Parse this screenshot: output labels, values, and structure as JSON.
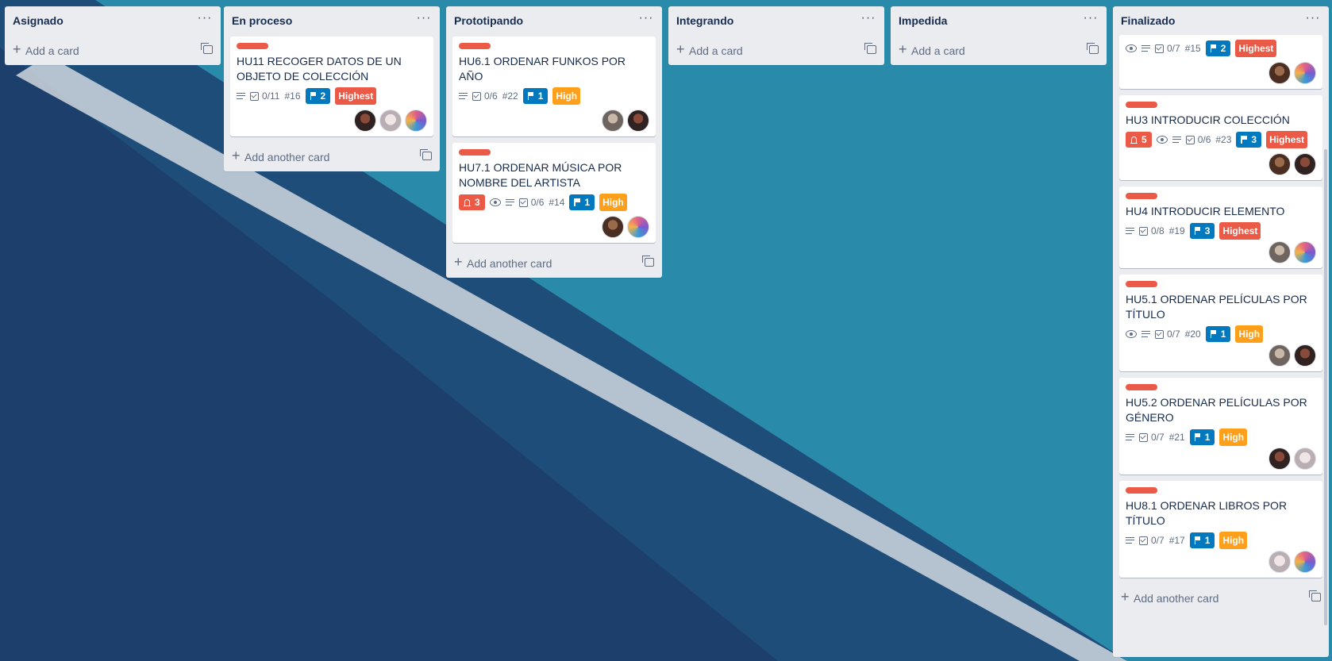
{
  "colors": {
    "board_bg": "#1d5a86",
    "list_bg": "#ebecf0",
    "red": "#eb5a46",
    "blue": "#0079bf",
    "orange": "#ff9f1a"
  },
  "icons": [
    "more-icon",
    "plus-icon",
    "template-icon",
    "description-icon",
    "checklist-icon",
    "flag-icon",
    "bell-icon",
    "eye-icon"
  ],
  "lists": [
    {
      "title": "Asignado",
      "add_label": "Add a card"
    },
    {
      "title": "En proceso",
      "add_label": "Add another card",
      "cards": [
        {
          "title": "HU11 RECOGER DATOS DE UN OBJETO DE COLECCIÓN",
          "checklist": "0/11",
          "number": "#16",
          "flag": "2",
          "priority": "Highest"
        }
      ]
    },
    {
      "title": "Prototipando",
      "add_label": "Add another card",
      "cards": [
        {
          "title": "HU6.1 ORDENAR FUNKOS POR AÑO",
          "checklist": "0/6",
          "number": "#22",
          "flag": "1",
          "priority": "High"
        },
        {
          "title": "HU7.1 ORDENAR MÚSICA POR NOMBRE DEL ARTISTA",
          "notifications": "3",
          "checklist": "0/6",
          "number": "#14",
          "flag": "1",
          "priority": "High"
        }
      ]
    },
    {
      "title": "Integrando",
      "add_label": "Add a card"
    },
    {
      "title": "Impedida",
      "add_label": "Add a card"
    },
    {
      "title": "Finalizado",
      "add_label": "Add another card",
      "cards": [
        {
          "checklist": "0/7",
          "number": "#15",
          "flag": "2",
          "priority": "Highest"
        },
        {
          "title": "HU3 INTRODUCIR COLECCIÓN",
          "notifications": "5",
          "checklist": "0/6",
          "number": "#23",
          "flag": "3",
          "priority": "Highest"
        },
        {
          "title": "HU4 INTRODUCIR ELEMENTO",
          "checklist": "0/8",
          "number": "#19",
          "flag": "3",
          "priority": "Highest"
        },
        {
          "title": "HU5.1 ORDENAR PELÍCULAS POR TÍTULO",
          "checklist": "0/7",
          "number": "#20",
          "flag": "1",
          "priority": "High"
        },
        {
          "title": "HU5.2 ORDENAR PELÍCULAS POR GÉNERO",
          "checklist": "0/7",
          "number": "#21",
          "flag": "1",
          "priority": "High"
        },
        {
          "title": "HU8.1 ORDENAR LIBROS POR TÍTULO",
          "checklist": "0/7",
          "number": "#17",
          "flag": "1",
          "priority": "High"
        }
      ]
    }
  ]
}
